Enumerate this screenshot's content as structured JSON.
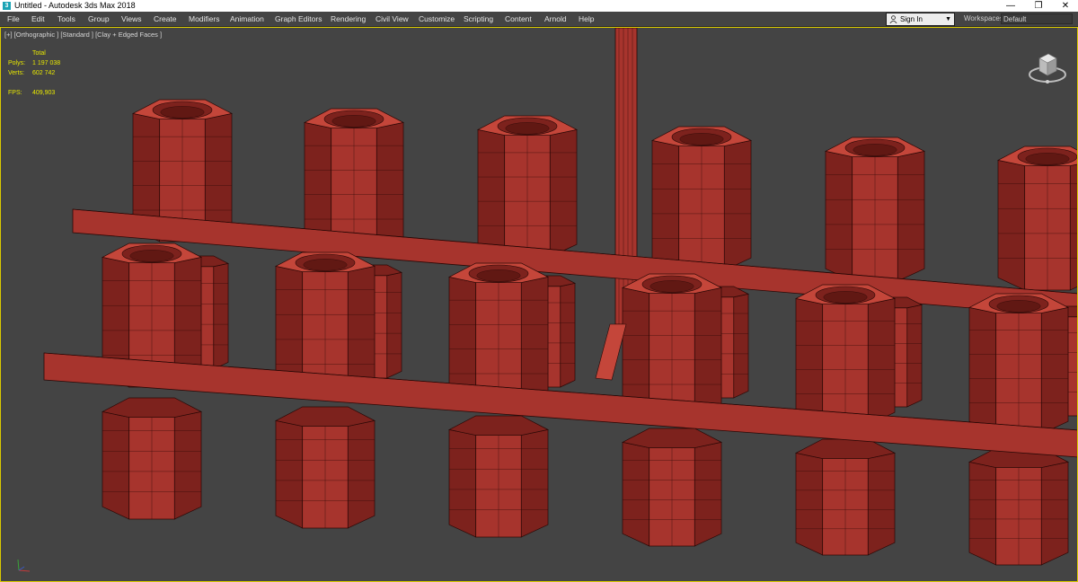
{
  "window": {
    "title": "Untitled - Autodesk 3ds Max 2018",
    "app_icon": "3ds-max-icon",
    "minimize": "—",
    "maximize": "❐",
    "close": "✕"
  },
  "menu": [
    {
      "label": "File"
    },
    {
      "label": "Edit"
    },
    {
      "label": "Tools"
    },
    {
      "label": "Group"
    },
    {
      "label": "Views"
    },
    {
      "label": "Create"
    },
    {
      "label": "Modifiers"
    },
    {
      "label": "Animation"
    },
    {
      "label": "Graph Editors"
    },
    {
      "label": "Rendering"
    },
    {
      "label": "Civil View"
    },
    {
      "label": "Customize"
    },
    {
      "label": "Scripting"
    },
    {
      "label": "Content"
    },
    {
      "label": "Arnold"
    },
    {
      "label": "Help"
    }
  ],
  "signin": {
    "label": "Sign In",
    "arrow": "▼",
    "icon": "user-icon"
  },
  "workspaces": {
    "label": "Workspaces:",
    "value": "Default"
  },
  "viewport": {
    "label": "[+] [Orthographic ] [Standard ] [Clay + Edged Faces ]",
    "stats": {
      "header": "Total",
      "polys_label": "Polys:",
      "polys": "1 197 038",
      "verts_label": "Verts:",
      "verts": "602 742",
      "fps_label": "FPS:",
      "fps": "409,903"
    },
    "viewcube_icon": "viewcube-icon",
    "axis_icon": "axis-gizmo-icon"
  },
  "colors": {
    "viewport_bg": "#444444",
    "clay_front": "#a7342d",
    "clay_side": "#7d221d",
    "clay_top": "#c4463a",
    "wire": "#2a0806",
    "active_border": "#d8c800",
    "stats_text": "#e8e800"
  }
}
